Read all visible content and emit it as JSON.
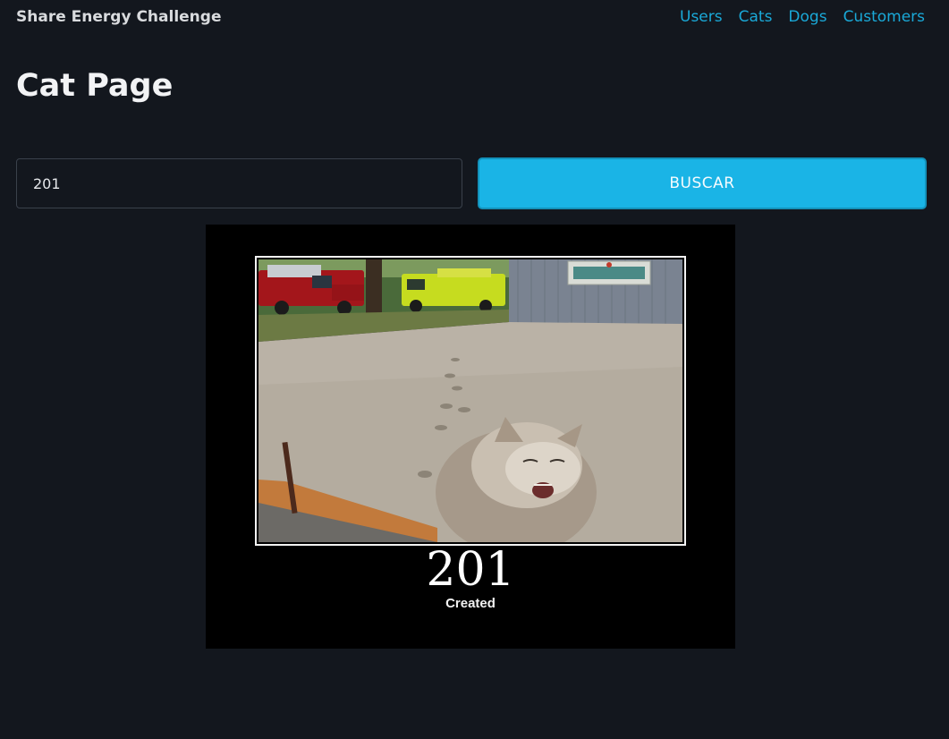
{
  "header": {
    "brand": "Share Energy Challenge",
    "nav": [
      "Users",
      "Cats",
      "Dogs",
      "Customers"
    ]
  },
  "main": {
    "title": "Cat Page",
    "search": {
      "value": "201",
      "button_label": "BUSCAR"
    },
    "cat_image": {
      "code": "201",
      "text": "Created"
    }
  },
  "colors": {
    "background": "#13171e",
    "accent": "#1ab4e6",
    "link": "#1aa9d8"
  }
}
